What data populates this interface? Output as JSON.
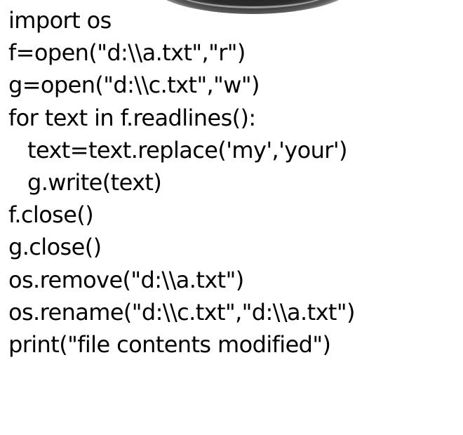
{
  "code": {
    "lines": [
      "import os",
      "f=open(\"d:\\\\a.txt\",\"r\")",
      "g=open(\"d:\\\\c.txt\",\"w\")",
      "for text in f.readlines():",
      "text=text.replace('my','your')",
      "g.write(text)",
      "f.close()",
      "g.close()",
      "os.remove(\"d:\\\\a.txt\")",
      "os.rename(\"d:\\\\c.txt\",\"d:\\\\a.txt\")",
      "print(\"file contents modified\")"
    ]
  }
}
